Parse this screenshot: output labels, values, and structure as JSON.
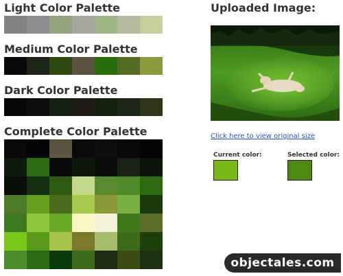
{
  "light": {
    "title": "Light Color Palette",
    "colors": [
      "#838385",
      "#8e9090",
      "#93a27e",
      "#a7a79d",
      "#9db685",
      "#b4bb9e",
      "#c5cf9d"
    ]
  },
  "medium": {
    "title": "Medium Color Palette",
    "colors": [
      "#0a0a0a",
      "#1f2419",
      "#2e4a10",
      "#5a5540",
      "#2a6c0a",
      "#566a24",
      "#8a9a3c"
    ]
  },
  "dark": {
    "title": "Dark Color Palette",
    "colors": [
      "#080808",
      "#0e100e",
      "#182212",
      "#1f1c1a",
      "#12200c",
      "#1e2416",
      "#30361a"
    ]
  },
  "complete": {
    "title": "Complete Color Palette",
    "rows": [
      [
        "#0a0a0a",
        "#050505",
        "#5a5540",
        "#0b0b0b",
        "#0e100e",
        "#0a0a0a",
        "#050505"
      ],
      [
        "#0e1a0e",
        "#2e6a12",
        "#0a0a0a",
        "#10180e",
        "#0a0c0a",
        "#1a2216",
        "#0c140c"
      ],
      [
        "#0a0f0a",
        "#142e10",
        "#2e5a14",
        "#c4d98c",
        "#5a8a30",
        "#4e8a2a",
        "#2e6a12"
      ],
      [
        "#4e7a2a",
        "#66a020",
        "#4a6a1e",
        "#a6ca4e",
        "#8a9a3a",
        "#7ab044",
        "#1a3a0c"
      ],
      [
        "#3e7a20",
        "#8ec83a",
        "#6aa828",
        "#f9f7c4",
        "#f2f2d6",
        "#3e7a1c",
        "#5e6e2a"
      ],
      [
        "#7ac81a",
        "#5a9a1c",
        "#a6c44a",
        "#7a7a2a",
        "#a6bc6c",
        "#3e6a1a",
        "#1e3e0c"
      ],
      [
        "#4e8a2e",
        "#2e6a12",
        "#0a3a0a",
        "#3e6a1c",
        "#1e2c14",
        "#3e4a14",
        "#1e3210"
      ]
    ]
  },
  "uploaded": {
    "title": "Uploaded Image:",
    "link_text": "Click here to view original size"
  },
  "current": {
    "label": "Current color:",
    "color": "#7ab81a"
  },
  "selected": {
    "label": "Selected color:",
    "color": "#4e8a12"
  },
  "watermark": {
    "text": "objectales.com"
  }
}
